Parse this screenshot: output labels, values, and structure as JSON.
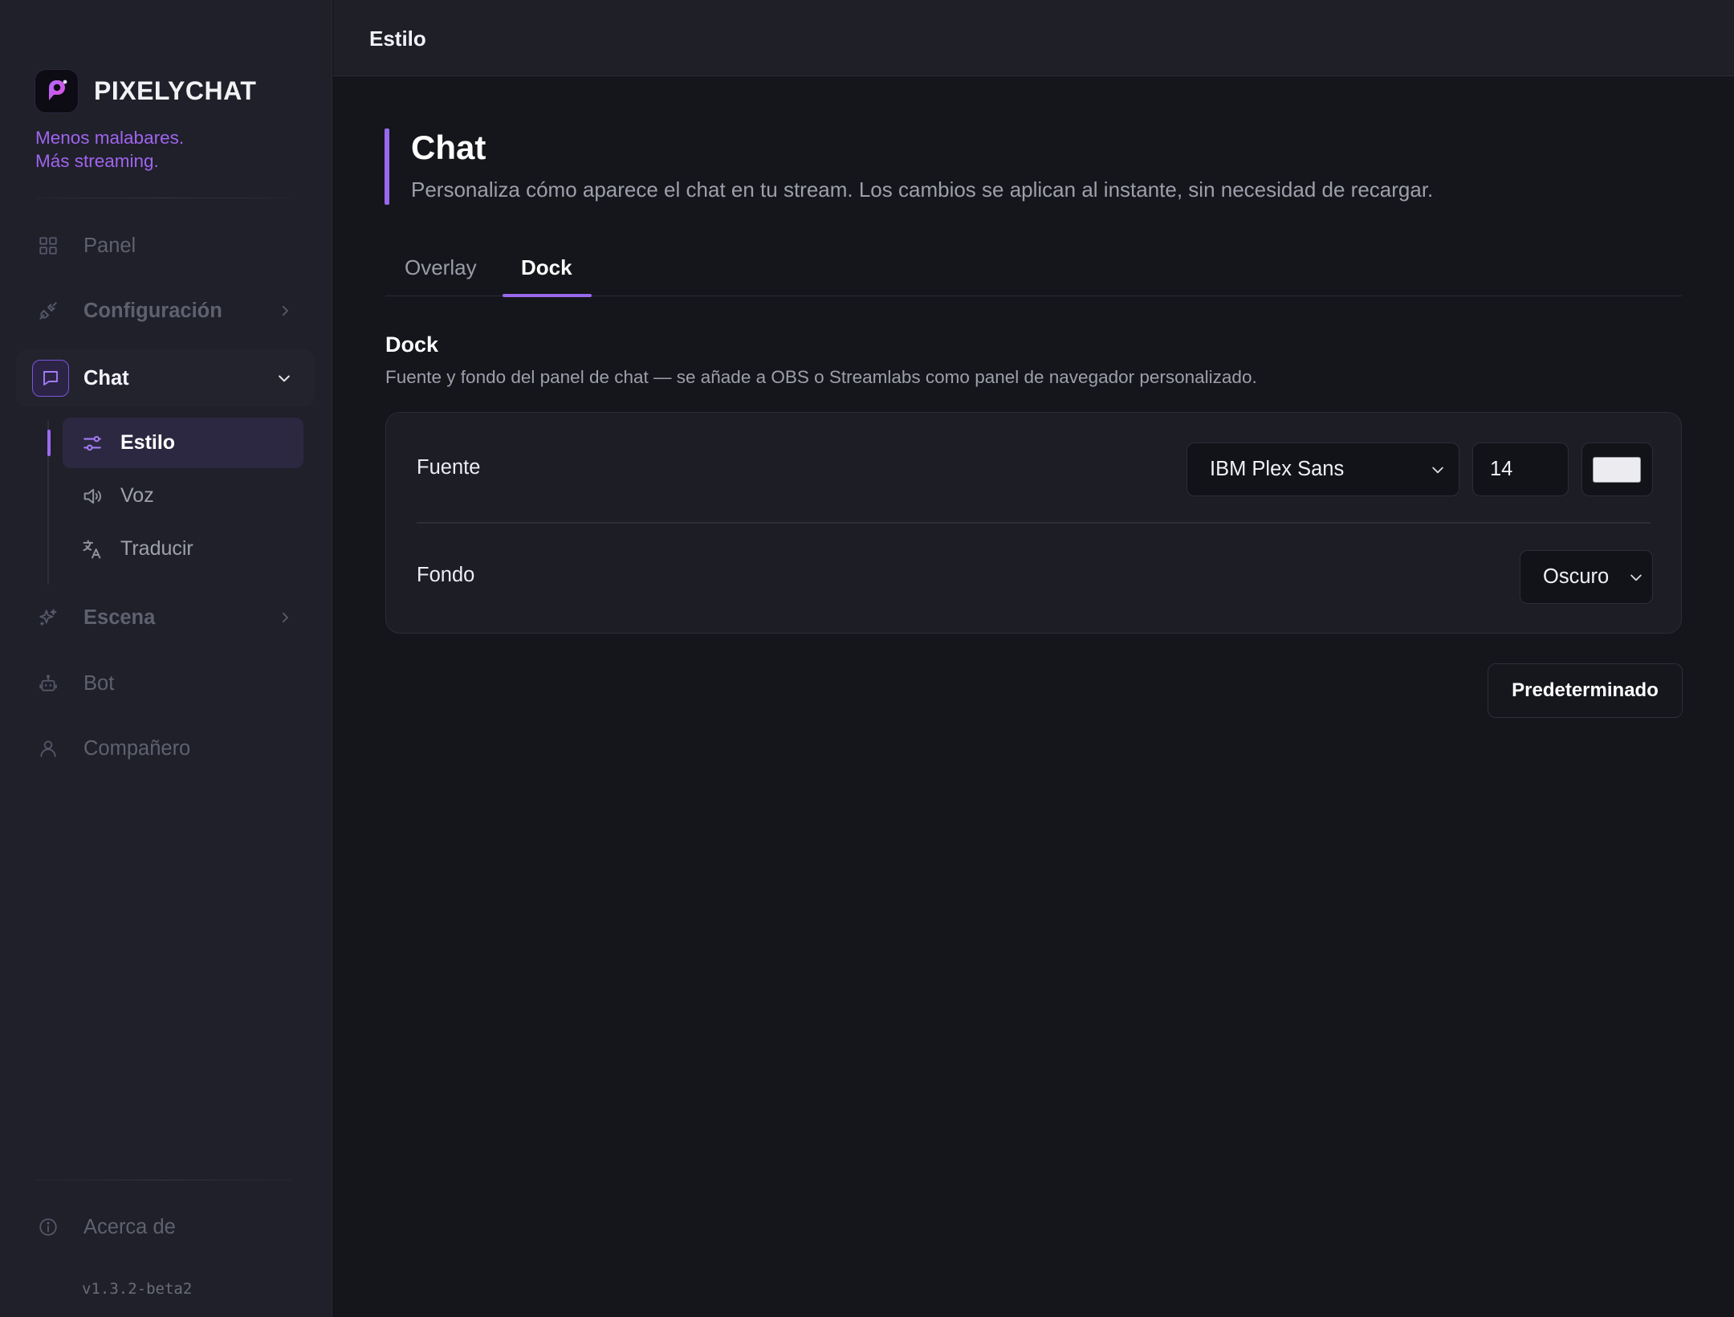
{
  "app": {
    "name": "PIXELYCHAT",
    "tagline_line1": "Menos malabares.",
    "tagline_line2": "Más streaming.",
    "version": "v1.3.2-beta2"
  },
  "sidebar": {
    "items": [
      {
        "label": "Panel",
        "icon": "grid-icon"
      },
      {
        "label": "Configuración",
        "icon": "plug-icon",
        "expandable": true
      },
      {
        "label": "Chat",
        "icon": "chat-bubble-icon",
        "expanded": true,
        "active": true
      },
      {
        "label": "Escena",
        "icon": "sparkles-icon",
        "expandable": true
      },
      {
        "label": "Bot",
        "icon": "robot-icon"
      },
      {
        "label": "Compañero",
        "icon": "user-icon"
      }
    ],
    "chat_subitems": [
      {
        "label": "Estilo",
        "icon": "sliders-icon",
        "active": true
      },
      {
        "label": "Voz",
        "icon": "speaker-icon"
      },
      {
        "label": "Traducir",
        "icon": "translate-icon"
      }
    ],
    "footer": {
      "label": "Acerca de",
      "icon": "info-icon"
    }
  },
  "topbar": {
    "title": "Estilo"
  },
  "page": {
    "title": "Chat",
    "subtitle": "Personaliza cómo aparece el chat en tu stream. Los cambios se aplican al instante, sin necesidad de recargar.",
    "tabs": [
      {
        "label": "Overlay",
        "active": false
      },
      {
        "label": "Dock",
        "active": true
      }
    ]
  },
  "dock": {
    "title": "Dock",
    "description": "Fuente y fondo del panel de chat — se añade a OBS o Streamlabs como panel de navegador personalizado.",
    "font_label": "Fuente",
    "font_value": "IBM Plex Sans",
    "font_size": "14",
    "font_color": "#ececf0",
    "background_label": "Fondo",
    "background_value": "Oscuro",
    "reset_label": "Predeterminado"
  },
  "colors": {
    "accent": "#9868ee",
    "sidebar_bg": "#1f2029",
    "main_bg": "#15161b"
  }
}
